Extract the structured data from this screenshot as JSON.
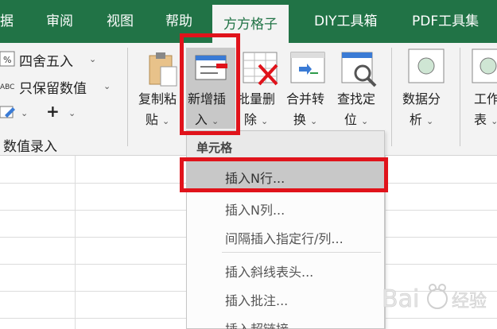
{
  "tabs": {
    "partial": "据",
    "review": "审阅",
    "view": "视图",
    "help": "帮助",
    "active": "方方格子",
    "diy": "DIY工具箱",
    "pdf": "PDF工具集"
  },
  "ribbon": {
    "round": "四舍五入",
    "keep_values": "只保留数值",
    "plus": "+",
    "group_label": "数值录入",
    "copy_paste": [
      "复制粘",
      "贴"
    ],
    "insert": [
      "新增插",
      "入"
    ],
    "batch_delete": [
      "批量删",
      "除"
    ],
    "merge": [
      "合并转",
      "换"
    ],
    "find": [
      "查找定",
      "位"
    ],
    "analysis": [
      "数据分",
      "析"
    ],
    "worksheet": [
      "工作",
      "表"
    ]
  },
  "dropdown": {
    "header": "单元格",
    "items": [
      "插入N行...",
      "插入N列...",
      "间隔插入指定行/列...",
      "插入斜线表头...",
      "插入批注...",
      "插入超链接..."
    ]
  },
  "colors": {
    "tab_green": "#217346",
    "highlight_red": "#e0131b"
  }
}
